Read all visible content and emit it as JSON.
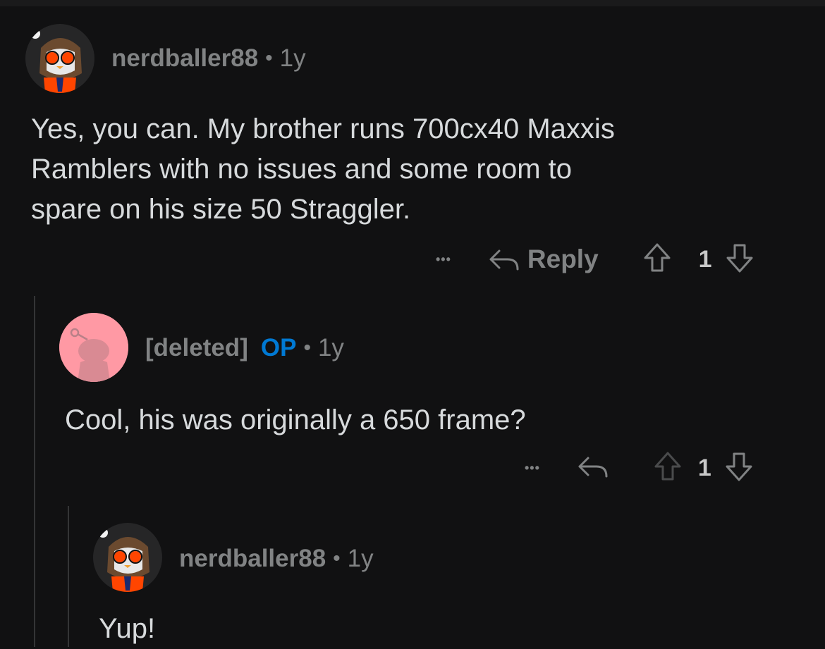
{
  "comments": [
    {
      "author": "nerdballer88",
      "separator": "•",
      "age": "1y",
      "body_lines": [
        "Yes, you can. My brother runs 700cx40 Maxxis",
        "Ramblers with no issues and some room to",
        "spare on his size 50 Straggler."
      ],
      "more": "•••",
      "reply_label": "Reply",
      "score": "1"
    },
    {
      "author": "[deleted]",
      "op_badge": "OP",
      "separator": "•",
      "age": "1y",
      "body_lines": [
        "Cool, his was originally a 650 frame?"
      ],
      "more": "•••",
      "score": "1"
    },
    {
      "author": "nerdballer88",
      "separator": "•",
      "age": "1y",
      "body_lines": [
        "Yup!"
      ]
    }
  ],
  "colors": {
    "background": "#111112",
    "meta_text": "#818384",
    "body_text": "#d7dadc",
    "op_badge": "#0079d3",
    "thread_line": "#343536"
  }
}
